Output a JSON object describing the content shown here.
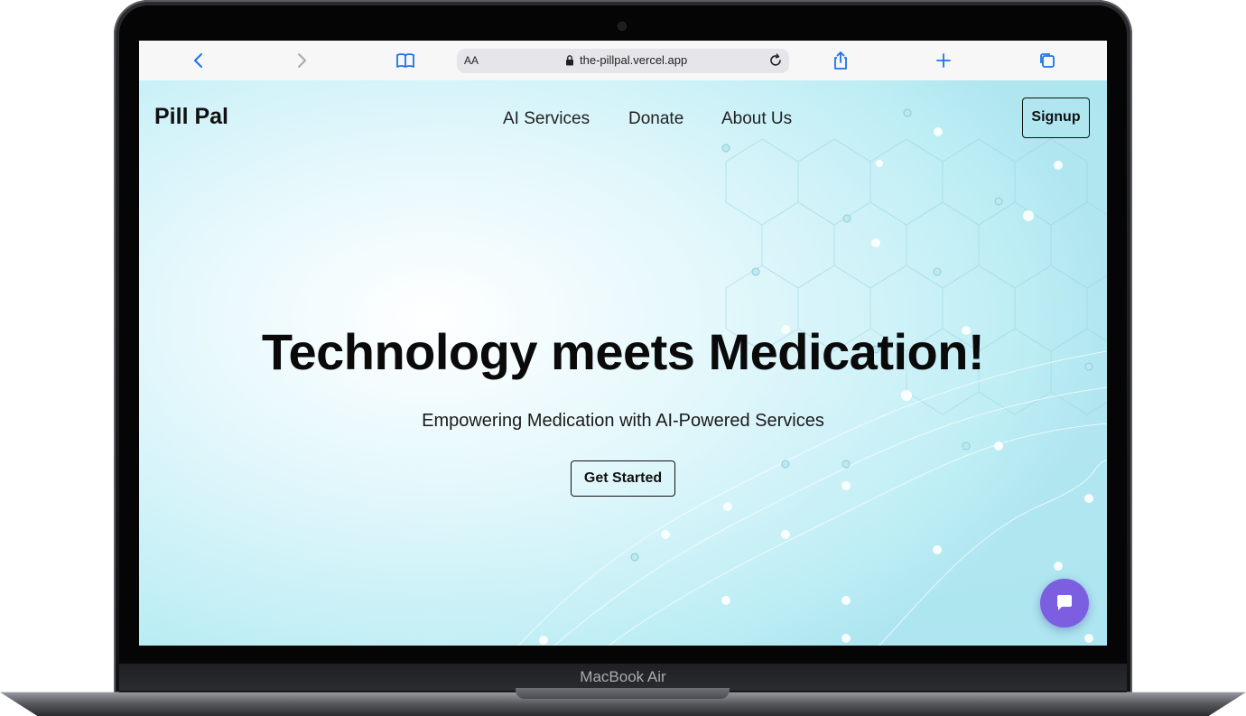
{
  "device": {
    "label": "MacBook Air"
  },
  "browser": {
    "text_size_label": "AA",
    "url": "the-pillpal.vercel.app"
  },
  "site": {
    "logo": "Pill Pal",
    "nav": [
      "AI Services",
      "Donate",
      "About Us"
    ],
    "signup_label": "Signup",
    "headline": "Technology meets Medication!",
    "subheadline": "Empowering Medication with AI-Powered Services",
    "cta_label": "Get Started"
  },
  "colors": {
    "accent": "#1a73e8",
    "chat_button": "#7b5fe0",
    "background": "#b8ecf4"
  },
  "icons": [
    "back-icon",
    "forward-icon",
    "bookmarks-icon",
    "lock-icon",
    "reload-icon",
    "share-icon",
    "new-tab-icon",
    "tabs-icon",
    "chat-icon"
  ]
}
